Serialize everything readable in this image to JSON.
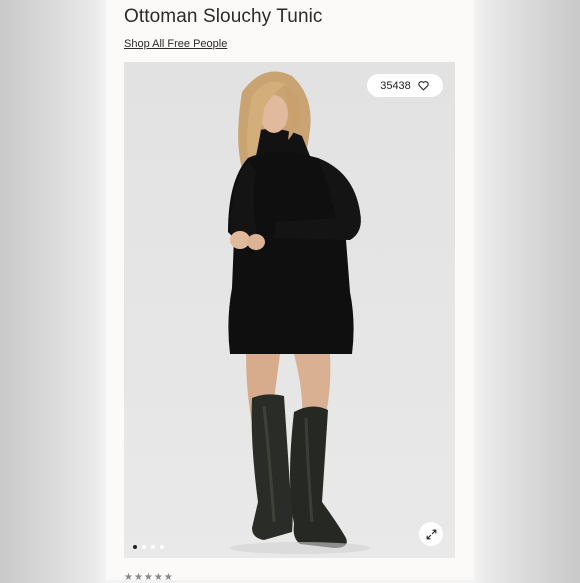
{
  "product": {
    "title": "Ottoman Slouchy Tunic",
    "shop_link": "Shop All Free People"
  },
  "gallery": {
    "favorite_count": "35438",
    "image_count": 4,
    "active_index": 0,
    "image_description": "Model wearing black oversized knit tunic dress with tall black leather boots"
  },
  "icons": {
    "favorite": "heart-icon",
    "expand": "expand-arrows-icon"
  },
  "colors": {
    "background": "#fbfaf8",
    "text": "#2b2b2b",
    "photo_bg": "#e4e4e4"
  }
}
